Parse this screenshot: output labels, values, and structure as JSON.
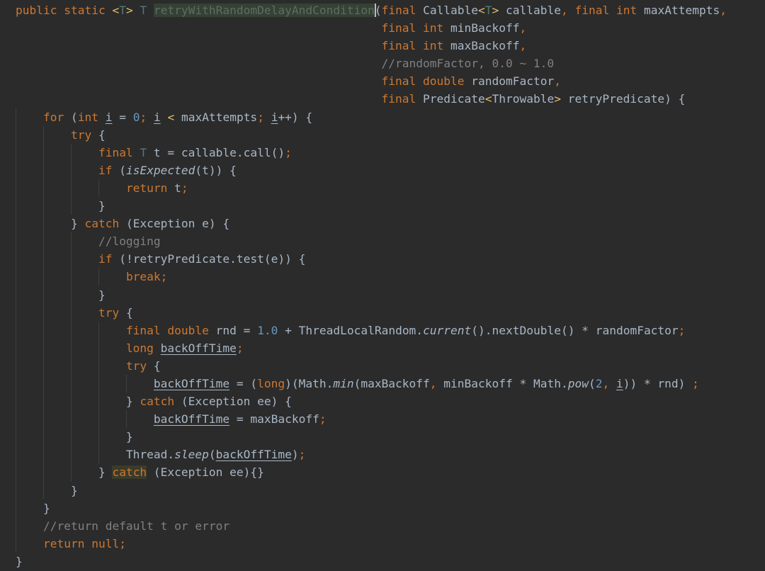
{
  "editor": {
    "language": "Java",
    "theme": "Darcula",
    "background": "#2b2b2b",
    "colors": {
      "keyword": "#cc7832",
      "identifier": "#a9b7c6",
      "number": "#6897bb",
      "comment": "#808080",
      "type_parameter": "#507874",
      "generic_bracket": "#e8bf6a"
    },
    "highlighted_symbol": "retryWithRandomDelayAndCondition",
    "highlighted_keyword": "catch"
  },
  "code_lines": [
    "public static <T> T retryWithRandomDelayAndCondition(final Callable<T> callable, final int maxAttempts,",
    "                                                     final int minBackoff,",
    "                                                     final int maxBackoff,",
    "                                                     //randomFactor, 0.0 ~ 1.0",
    "                                                     final double randomFactor,",
    "                                                     final Predicate<Throwable> retryPredicate) {",
    "    for (int i = 0; i < maxAttempts; i++) {",
    "        try {",
    "            final T t = callable.call();",
    "            if (isExpected(t)) {",
    "                return t;",
    "            }",
    "        } catch (Exception e) {",
    "            //logging",
    "            if (!retryPredicate.test(e)) {",
    "                break;",
    "            }",
    "            try {",
    "                final double rnd = 1.0 + ThreadLocalRandom.current().nextDouble() * randomFactor;",
    "                long backOffTime;",
    "                try {",
    "                    backOffTime = (long)(Math.min(maxBackoff, minBackoff * Math.pow(2, i)) * rnd) ;",
    "                } catch (Exception ee) {",
    "                    backOffTime = maxBackoff;",
    "                }",
    "                Thread.sleep(backOffTime);",
    "            } catch (Exception ee){}",
    "        }",
    "    }",
    "    //return default t or error",
    "    return null;",
    "}"
  ]
}
